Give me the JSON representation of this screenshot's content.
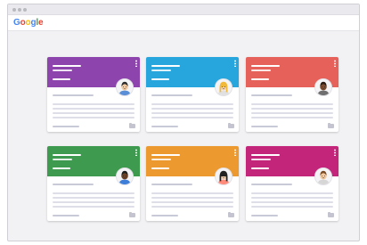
{
  "app": {
    "logo_letters": [
      {
        "ch": "G",
        "color": "#4285f4"
      },
      {
        "ch": "o",
        "color": "#ea4335"
      },
      {
        "ch": "o",
        "color": "#fbbc05"
      },
      {
        "ch": "g",
        "color": "#4285f4"
      },
      {
        "ch": "l",
        "color": "#34a853"
      },
      {
        "ch": "e",
        "color": "#ea4335"
      }
    ]
  },
  "cards": [
    {
      "header_color": "#8e44ad",
      "avatar": "avatar-boy-black-hair-icon"
    },
    {
      "header_color": "#26a6dc",
      "avatar": "avatar-girl-blonde-icon"
    },
    {
      "header_color": "#e5615a",
      "avatar": "avatar-dark-skin-person-icon"
    },
    {
      "header_color": "#3e9a4f",
      "avatar": "avatar-dark-skin-man-icon"
    },
    {
      "header_color": "#ec9a30",
      "avatar": "avatar-girl-black-hair-icon"
    },
    {
      "header_color": "#c2257a",
      "avatar": "avatar-boy-brown-hair-icon"
    }
  ]
}
